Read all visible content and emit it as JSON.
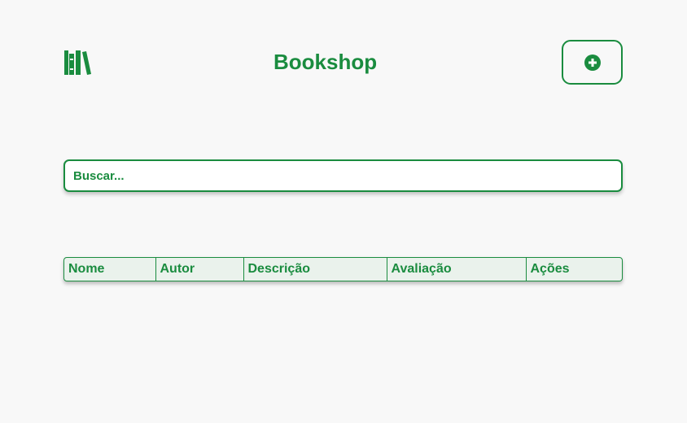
{
  "header": {
    "logo_icon": "books-icon",
    "title": "Bookshop",
    "add_icon": "plus-circle-icon"
  },
  "search": {
    "placeholder": "Buscar..."
  },
  "table": {
    "columns": [
      "Nome",
      "Autor",
      "Descrição",
      "Avaliação",
      "Ações"
    ],
    "rows": []
  },
  "colors": {
    "accent": "#1a8c3f",
    "background": "#f8f8f8",
    "table_header_bg": "#eaf2ec"
  }
}
